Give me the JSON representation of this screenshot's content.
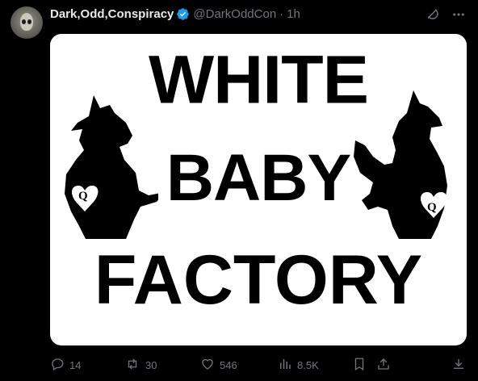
{
  "author": {
    "display_name": "Dark,Odd,Conspiracy",
    "handle": "@DarkOddCon",
    "separator": "·",
    "time": "1h",
    "verified": true
  },
  "media": {
    "lines": [
      "WHITE",
      "BABY",
      "FACTORY"
    ],
    "badge_letter": "Q"
  },
  "actions": {
    "replies": "14",
    "reposts": "30",
    "likes": "546",
    "views": "8.5K"
  },
  "colors": {
    "background": "#000000",
    "text_primary": "#e7e9ea",
    "text_secondary": "#71767b",
    "verified": "#1d9bf0"
  },
  "icons": [
    "grok-icon",
    "more-icon",
    "reply-icon",
    "repost-icon",
    "like-icon",
    "views-icon",
    "bookmark-icon",
    "share-icon",
    "download-icon"
  ]
}
